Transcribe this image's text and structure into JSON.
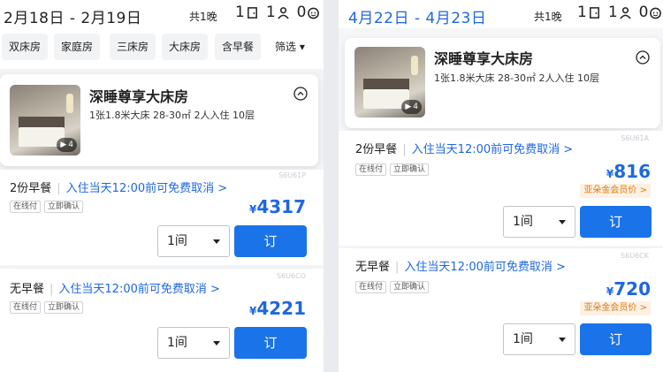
{
  "left": {
    "dates": "2月18日 - 2月19日",
    "nights": "共1晚",
    "rooms_count": "1",
    "adults_count": "1",
    "children_count": "0",
    "filters": [
      "双床房",
      "家庭房",
      "三床房",
      "大床房",
      "含早餐",
      "筛选 ▾"
    ],
    "room": {
      "title": "深睡尊享大床房",
      "spec": "1张1.8米大床  28-30㎡  2人入住  10层",
      "media_count": "4"
    },
    "offers": [
      {
        "code": "S6U61P",
        "meal": "2份早餐",
        "cancel": "入住当天12:00前可免费取消 >",
        "tags": [
          "在线付",
          "立即确认"
        ],
        "currency": "¥",
        "price": "4317",
        "qty": "1间",
        "book": "订"
      },
      {
        "code": "S6U6CO",
        "meal": "无早餐",
        "cancel": "入住当天12:00前可免费取消 >",
        "tags": [
          "在线付",
          "立即确认"
        ],
        "currency": "¥",
        "price": "4221",
        "qty": "1间",
        "book": "订"
      }
    ]
  },
  "right": {
    "dates": "4月22日 - 4月23日",
    "nights": "共1晚",
    "rooms_count": "1",
    "adults_count": "1",
    "children_count": "0",
    "room": {
      "title": "深睡尊享大床房",
      "spec": "1张1.8米大床  28-30㎡  2人入住  10层",
      "media_count": "4"
    },
    "offers": [
      {
        "code": "S6U61A",
        "meal": "2份早餐",
        "cancel": "入住当天12:00前可免费取消 >",
        "tags": [
          "在线付",
          "立即确认"
        ],
        "currency": "¥",
        "price": "816",
        "member": "亚朵金会员价 >",
        "qty": "1间",
        "book": "订"
      },
      {
        "code": "S6U6CK",
        "meal": "无早餐",
        "cancel": "入住当天12:00前可免费取消 >",
        "tags": [
          "在线付",
          "立即确认"
        ],
        "currency": "¥",
        "price": "720",
        "member": "亚朵金会员价 >",
        "qty": "1间",
        "book": "订"
      }
    ]
  },
  "colors": {
    "accent": "#1f67e0",
    "button": "#1a73e8",
    "member": "#e07a13"
  }
}
